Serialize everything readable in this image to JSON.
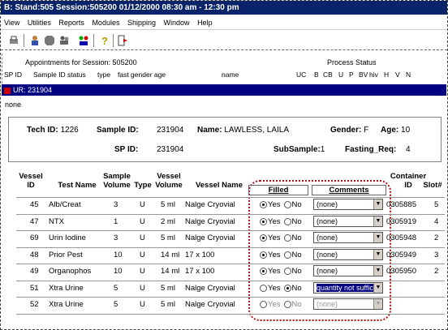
{
  "title": "B: Stand:505 Session:505200 01/12/2000 08:30 am - 12:30 pm",
  "menu": [
    "View",
    "Utilities",
    "Reports",
    "Modules",
    "Shipping",
    "Window",
    "Help"
  ],
  "toolbar_icons": [
    "print-icon",
    "person-icon",
    "stop-icon",
    "people-icon",
    "help-icon",
    "exit-icon"
  ],
  "appointments": {
    "title": "Appointments for Session: 505200",
    "process_status": "Process Status",
    "headers": [
      "SP ID",
      "Sample ID status",
      "type",
      "fast gender age",
      "name",
      "UC",
      "B",
      "CB",
      "U",
      "P",
      "BV",
      "hiv",
      "H",
      "V",
      "N"
    ]
  },
  "ur_bar": "UR: 231904",
  "none_label": "none",
  "panel": {
    "tech_id_label": "Tech ID:",
    "tech_id": "1226",
    "sample_id_label": "Sample ID:",
    "sample_id": "231904",
    "name_label": "Name:",
    "name": "LAWLESS, LAILA",
    "gender_label": "Gender:",
    "gender": "F",
    "age_label": "Age:",
    "age": "10",
    "sp_id_label": "SP ID:",
    "sp_id": "231904",
    "subsample_label": "SubSample:",
    "subsample": "1",
    "fasting_label": "Fasting_Req:",
    "fasting": "4"
  },
  "columns": {
    "vessel_id": "Vessel ID",
    "test_name": "Test Name",
    "sample_volume": "Sample Volume",
    "type": "Type",
    "vessel_volume": "Vessel Volume",
    "vessel_name": "Vessel Name",
    "filled": "Filled",
    "comments": "Comments",
    "container_id": "Container ID",
    "slot": "Slot#"
  },
  "rows": [
    {
      "id": "45",
      "test": "Alb/Creat",
      "svol": "3",
      "type": "U",
      "vvol": "5 ml",
      "vname": "Nalge Cryovial",
      "filled": "yes",
      "comment": "(none)",
      "container": "0305885",
      "slot": "5"
    },
    {
      "id": "47",
      "test": "NTX",
      "svol": "1",
      "type": "U",
      "vvol": "2 ml",
      "vname": "Nalge Cryovial",
      "filled": "yes",
      "comment": "(none)",
      "container": "0305919",
      "slot": "4"
    },
    {
      "id": "69",
      "test": "Urin Iodine",
      "svol": "3",
      "type": "U",
      "vvol": "5 ml",
      "vname": "Nalge Cryovial",
      "filled": "yes",
      "comment": "(none)",
      "container": "0305948",
      "slot": "2"
    },
    {
      "id": "48",
      "test": "Prior Pest",
      "svol": "10",
      "type": "U",
      "vvol": "14 ml",
      "vname": "17 x 100",
      "filled": "yes",
      "comment": "(none)",
      "container": "0305949",
      "slot": "3"
    },
    {
      "id": "49",
      "test": "Organophos",
      "svol": "10",
      "type": "U",
      "vvol": "14 ml",
      "vname": "17 x 100",
      "filled": "yes",
      "comment": "(none)",
      "container": "0305950",
      "slot": "2"
    },
    {
      "id": "51",
      "test": "Xtra Urine",
      "svol": "5",
      "type": "U",
      "vvol": "5 ml",
      "vname": "Nalge Cryovial",
      "filled": "no",
      "comment": "quantity not suffic",
      "container": "",
      "slot": ""
    },
    {
      "id": "52",
      "test": "Xtra Urine",
      "svol": "5",
      "type": "U",
      "vvol": "5 ml",
      "vname": "Nalge Cryovial",
      "filled": "none",
      "comment": "(none)",
      "container": "",
      "slot": ""
    }
  ],
  "radio_labels": {
    "yes": "Yes",
    "no": "No"
  }
}
